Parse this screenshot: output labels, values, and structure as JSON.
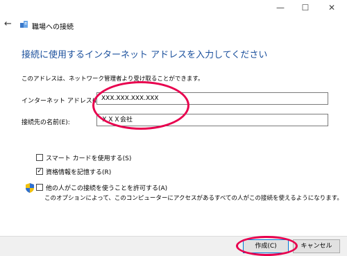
{
  "window": {
    "minimize": "—",
    "maximize": "☐",
    "close": "✕"
  },
  "header": {
    "title": "職場への接続"
  },
  "main": {
    "heading": "接続に使用するインターネット アドレスを入力してください",
    "description": "このアドレスは、ネットワーク管理者より受け取ることができます。",
    "internet_address": {
      "label": "インターネット アドレス(I):",
      "value": "XXX.XXX.XXX.XXX"
    },
    "destination_name": {
      "label": "接続先の名前(E):",
      "value": "ＸＸＸ会社"
    },
    "options": [
      {
        "label": "スマート カードを使用する(S)",
        "checked": false
      },
      {
        "label": "資格情報を記憶する(R)",
        "checked": true
      },
      {
        "label": "他の人がこの接続を使うことを許可する(A)",
        "checked": false
      }
    ],
    "allow_note": "このオプションによって、このコンピューターにアクセスがあるすべての人がこの接続を使えるようになります。"
  },
  "footer": {
    "create_label": "作成(C)",
    "cancel_label": "キャンセル"
  },
  "colors": {
    "heading": "#1a4f9c",
    "highlight": "#e8004e",
    "button_border": "#0078d7"
  },
  "icons": [
    "back-arrow-icon",
    "network-icon",
    "uac-shield-icon",
    "check-icon"
  ]
}
